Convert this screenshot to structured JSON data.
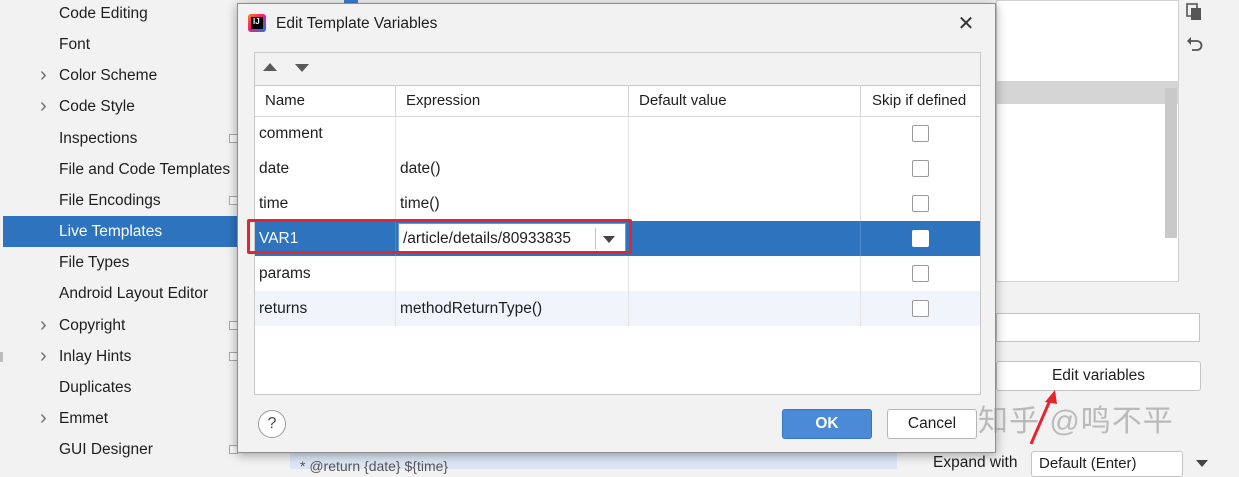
{
  "sidebar": {
    "items": [
      {
        "label": "Code Editing",
        "chevron": false,
        "selected": false,
        "marker": false
      },
      {
        "label": "Font",
        "chevron": false,
        "selected": false,
        "marker": false
      },
      {
        "label": "Color Scheme",
        "chevron": true,
        "selected": false,
        "marker": false
      },
      {
        "label": "Code Style",
        "chevron": true,
        "selected": false,
        "marker": false
      },
      {
        "label": "Inspections",
        "chevron": false,
        "selected": false,
        "marker": true
      },
      {
        "label": "File and Code Templates",
        "chevron": false,
        "selected": false,
        "marker": false
      },
      {
        "label": "File Encodings",
        "chevron": false,
        "selected": false,
        "marker": true
      },
      {
        "label": "Live Templates",
        "chevron": false,
        "selected": true,
        "marker": false
      },
      {
        "label": "File Types",
        "chevron": false,
        "selected": false,
        "marker": false
      },
      {
        "label": "Android Layout Editor",
        "chevron": false,
        "selected": false,
        "marker": false
      },
      {
        "label": "Copyright",
        "chevron": true,
        "selected": false,
        "marker": true
      },
      {
        "label": "Inlay Hints",
        "chevron": true,
        "selected": false,
        "marker": true
      },
      {
        "label": "Duplicates",
        "chevron": false,
        "selected": false,
        "marker": false
      },
      {
        "label": "Emmet",
        "chevron": true,
        "selected": false,
        "marker": false
      },
      {
        "label": "GUI Designer",
        "chevron": false,
        "selected": false,
        "marker": true
      }
    ]
  },
  "background": {
    "edit_variables_label": "Edit variables",
    "expand_with_label": "Expand with",
    "expand_with_value": "Default (Enter)",
    "editor_snippet": "* @return {date} ${time}"
  },
  "dialog": {
    "title": "Edit Template Variables",
    "close_glyph": "✕",
    "columns": [
      "Name",
      "Expression",
      "Default value",
      "Skip if defined"
    ],
    "rows": [
      {
        "name": "comment",
        "expression": "",
        "default": "",
        "skip": false
      },
      {
        "name": "date",
        "expression": "date()",
        "default": "",
        "skip": false
      },
      {
        "name": "time",
        "expression": "time()",
        "default": "",
        "skip": false
      },
      {
        "name": "VAR1",
        "expression": "/article/details/80933835",
        "default": "",
        "skip": false,
        "selected": true,
        "editing": true
      },
      {
        "name": "params",
        "expression": "",
        "default": "",
        "skip": false
      },
      {
        "name": "returns",
        "expression": "methodReturnType()",
        "default": "",
        "skip": false
      }
    ],
    "help_label": "?",
    "ok_label": "OK",
    "cancel_label": "Cancel"
  },
  "watermark": "知乎 @鸣不平",
  "colors": {
    "selection": "#2d73bd",
    "ok_button": "#4a8ad6",
    "highlight": "#e3262d"
  }
}
